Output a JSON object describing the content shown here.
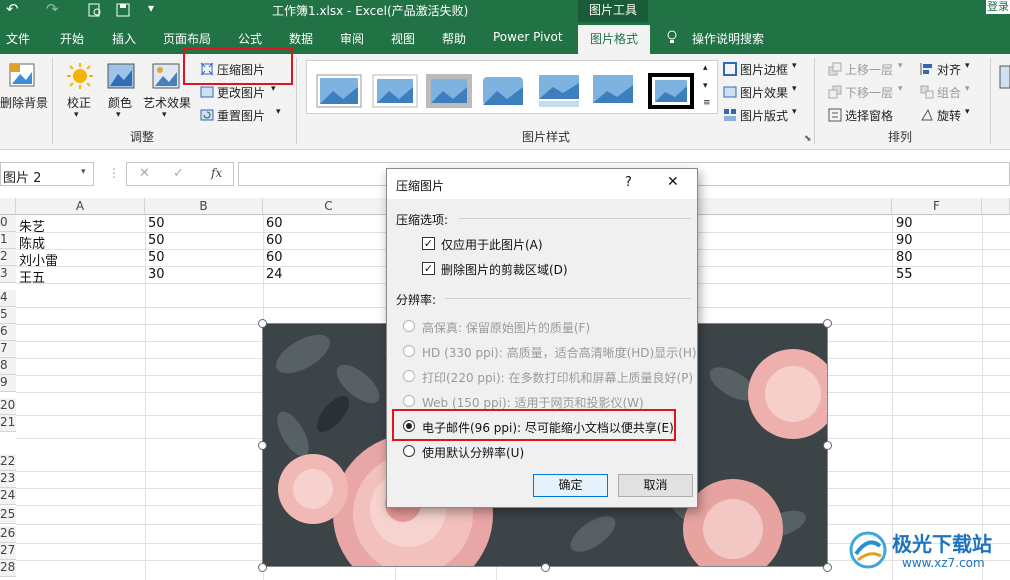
{
  "titlebar": {
    "undo": "↶",
    "redo": "↷",
    "title": "工作簿1.xlsx  -  Excel(产品激活失败)",
    "tools_tab": "图片工具",
    "login": "登录"
  },
  "menu": {
    "items": [
      "文件",
      "开始",
      "插入",
      "页面布局",
      "公式",
      "数据",
      "审阅",
      "视图",
      "帮助",
      "Power Pivot",
      "图片格式"
    ],
    "tell_me": "操作说明搜索"
  },
  "ribbon": {
    "remove_bg": "删除背景",
    "corrections": "校正",
    "color": "颜色",
    "artistic": "艺术效果",
    "compress": "压缩图片",
    "change": "更改图片",
    "reset": "重置图片",
    "group_adjust": "调整",
    "group_styles": "图片样式",
    "border": "图片边框",
    "effects": "图片效果",
    "layout": "图片版式",
    "bring_forward": "上移一层",
    "send_backward": "下移一层",
    "selection_pane": "选择窗格",
    "align": "对齐",
    "group_obj": "组合",
    "rotate": "旋转",
    "group_arrange": "排列"
  },
  "formula_bar": {
    "name_box": "图片 2",
    "fx": "fx"
  },
  "sheet": {
    "columns": [
      "A",
      "B",
      "C",
      "F"
    ],
    "row_numbers": [
      "0",
      "1",
      "2",
      "3",
      "4",
      "5",
      "6",
      "7",
      "8",
      "9",
      "20",
      "21",
      "22",
      "23",
      "24",
      "25",
      "26",
      "27",
      "28"
    ],
    "rows": [
      {
        "a": "朱艺",
        "b": "50",
        "c": "60",
        "f": "90"
      },
      {
        "a": "陈成",
        "b": "50",
        "c": "60",
        "f": "90"
      },
      {
        "a": "刘小雷",
        "b": "50",
        "c": "60",
        "f": "80"
      },
      {
        "a": "王五",
        "b": "30",
        "c": "24",
        "f": "55"
      }
    ]
  },
  "dialog": {
    "title": "压缩图片",
    "help": "?",
    "close": "✕",
    "section_compress": "压缩选项:",
    "opt_only_this": "仅应用于此图片(A)",
    "opt_delete_crop": "删除图片的剪裁区域(D)",
    "checked_mark": "✓",
    "section_resolution": "分辨率:",
    "res_options": [
      "高保真: 保留原始图片的质量(F)",
      "HD (330 ppi): 高质量，适合高清晰度(HD)显示(H)",
      "打印(220 ppi): 在多数打印机和屏幕上质量良好(P)",
      "Web (150 ppi): 适用于网页和投影仪(W)",
      "电子邮件(96 ppi): 尽可能缩小文档以便共享(E)",
      "使用默认分辨率(U)"
    ],
    "selected_index": 4,
    "ok": "确定",
    "cancel": "取消"
  },
  "watermark": {
    "name": "极光下载站",
    "url": "www.xz7.com"
  },
  "colors": {
    "excel_green": "#217346",
    "highlight_red": "#e1141d"
  }
}
